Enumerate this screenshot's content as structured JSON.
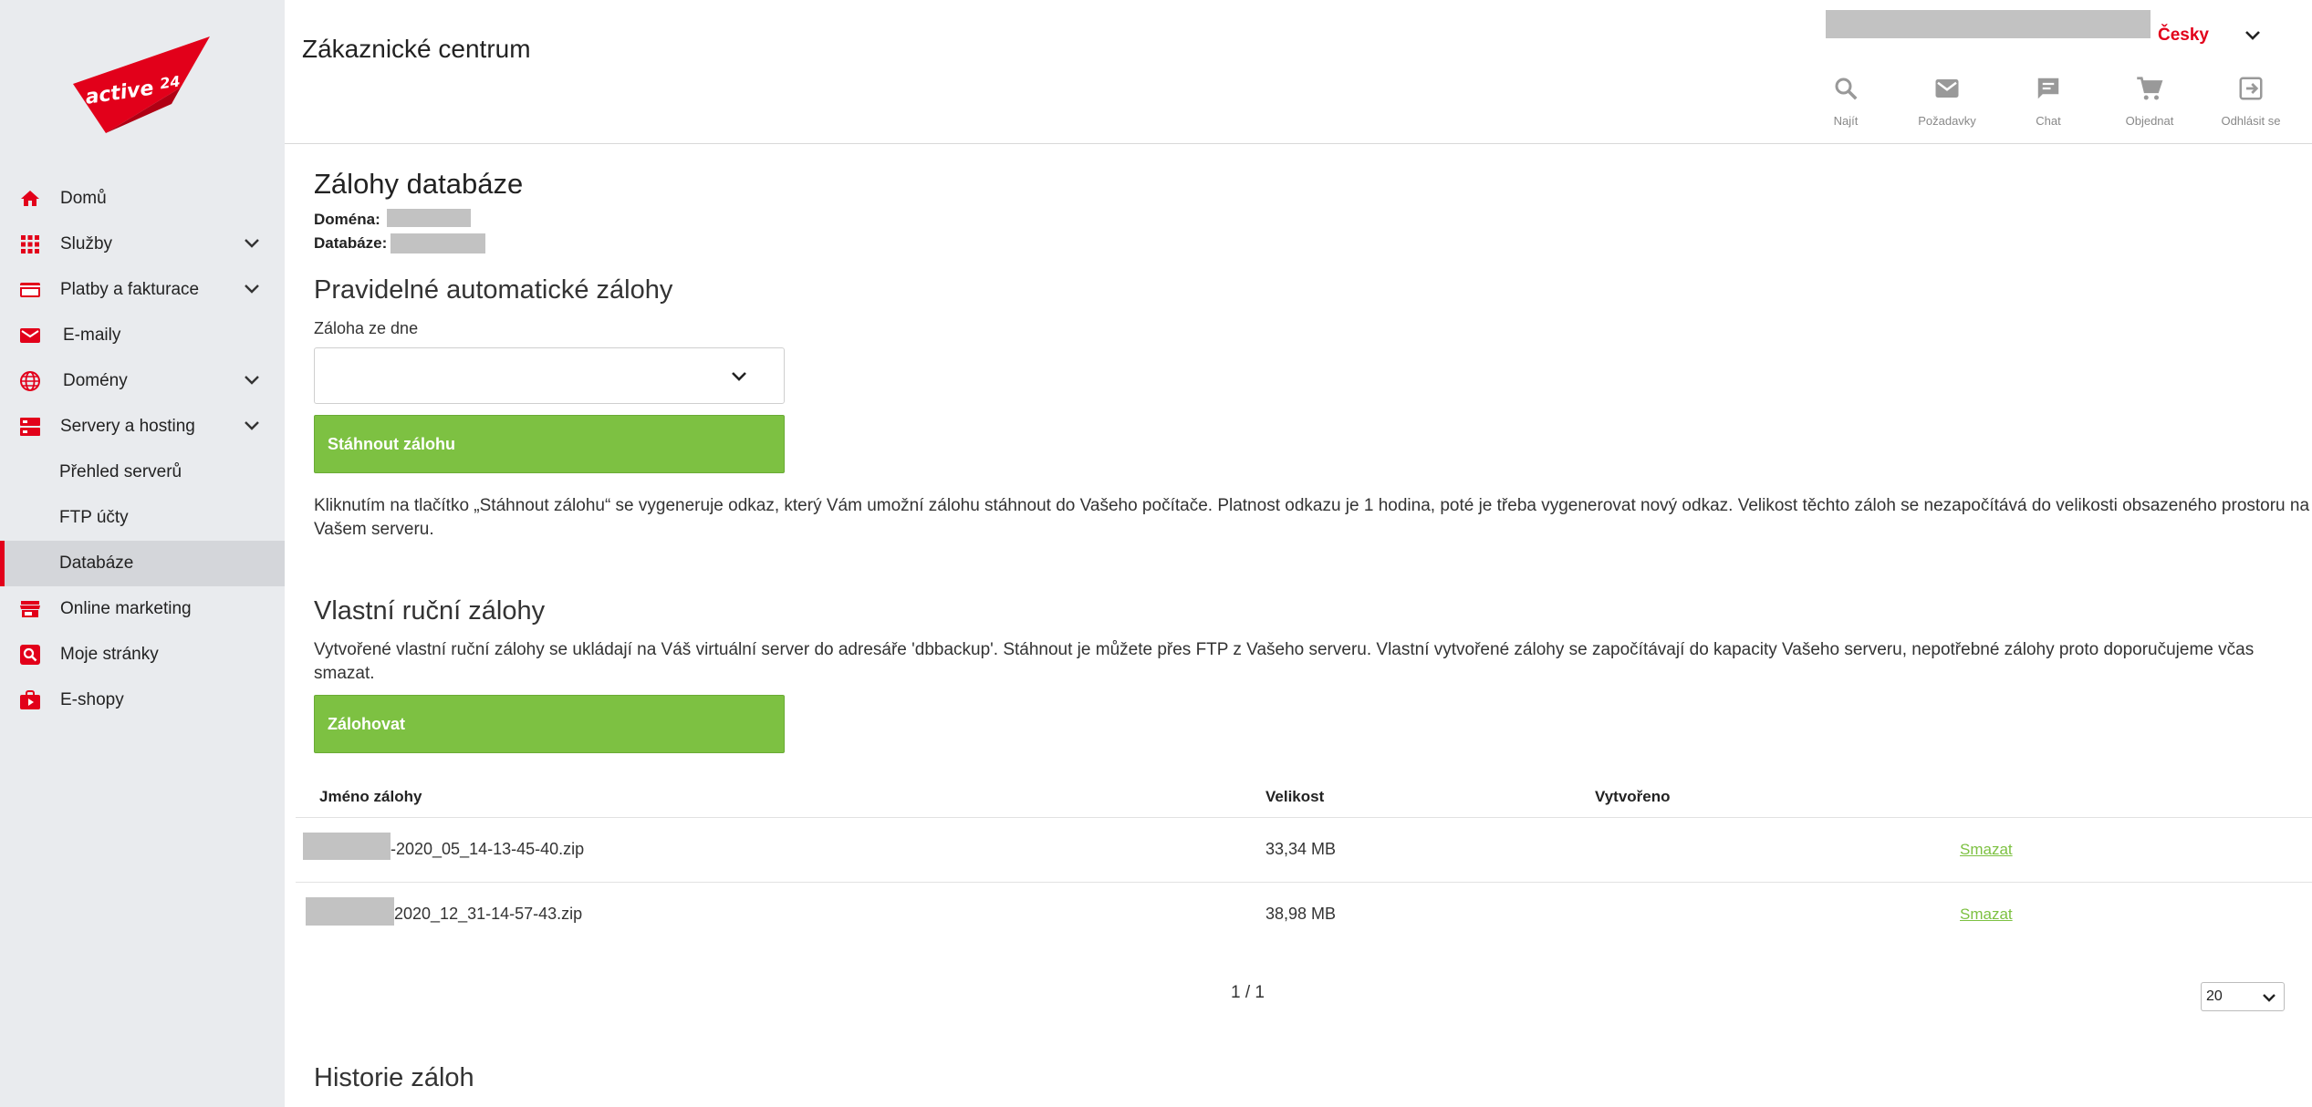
{
  "brand": {
    "name": "active24",
    "accent": "#e2001a",
    "green": "#7dc142"
  },
  "sidebar": {
    "items": [
      {
        "label": "Domů",
        "icon": "home-icon",
        "expandable": false
      },
      {
        "label": "Služby",
        "icon": "grid-icon",
        "expandable": true
      },
      {
        "label": "Platby a fakturace",
        "icon": "credit-card-icon",
        "expandable": true
      },
      {
        "label": "E-maily",
        "icon": "mail-icon",
        "expandable": false
      },
      {
        "label": "Domény",
        "icon": "globe-icon",
        "expandable": true
      },
      {
        "label": "Servery a hosting",
        "icon": "server-icon",
        "expandable": true
      },
      {
        "label": "Přehled serverů",
        "sub": true
      },
      {
        "label": "FTP účty",
        "sub": true
      },
      {
        "label": "Databáze",
        "sub": true,
        "active": true
      },
      {
        "label": "Online marketing",
        "icon": "store-icon",
        "expandable": false
      },
      {
        "label": "Moje stránky",
        "icon": "search-page-icon",
        "expandable": false
      },
      {
        "label": "E-shopy",
        "icon": "shop-bag-icon",
        "expandable": false
      }
    ]
  },
  "header": {
    "title": "Zákaznické centrum",
    "language": "Česky",
    "actions": [
      {
        "label": "Najít",
        "icon": "search-icon"
      },
      {
        "label": "Požadavky",
        "icon": "mail-icon"
      },
      {
        "label": "Chat",
        "icon": "chat-icon"
      },
      {
        "label": "Objednat",
        "icon": "cart-icon"
      },
      {
        "label": "Odhlásit se",
        "icon": "logout-icon"
      }
    ]
  },
  "main": {
    "title": "Zálohy databáze",
    "domain_label": "Doména:",
    "database_label": "Databáze:",
    "auto": {
      "heading": "Pravidelné automatické zálohy",
      "select_label": "Záloha ze dne",
      "select_value": "",
      "download_button": "Stáhnout zálohu",
      "description_line1": "Kliknutím na tlačítko „Stáhnout zálohu“ se vygeneruje odkaz, který Vám umožní zálohu stáhnout do Vašeho počítače. Platnost odkazu je 1 hodina, poté je třeba vygenerovat nový odkaz. Velikost těchto záloh se nezapočítává do velikosti obsazeného prostoru na",
      "description_line2": "Vašem serveru."
    },
    "manual": {
      "heading": "Vlastní ruční zálohy",
      "description": "Vytvořené vlastní ruční zálohy se ukládají na Váš virtuální server do adresáře 'dbbackup'. Stáhnout je můžete přes FTP z Vašeho serveru. Vlastní vytvořené zálohy se započítávají do kapacity Vašeho serveru, nepotřebné zálohy proto doporučujeme včas smazat.",
      "backup_button": "Zálohovat"
    },
    "table": {
      "columns": [
        "Jméno zálohy",
        "Velikost",
        "Vytvořeno",
        ""
      ],
      "rows": [
        {
          "name": "-2020_05_14-13-45-40.zip",
          "size": "33,34 MB",
          "created": "",
          "action": "Smazat"
        },
        {
          "name": "2020_12_31-14-57-43.zip",
          "size": "38,98 MB",
          "created": "",
          "action": "Smazat"
        }
      ]
    },
    "pagination": {
      "text": "1 / 1",
      "per_page": "20"
    },
    "history_heading": "Historie záloh"
  }
}
